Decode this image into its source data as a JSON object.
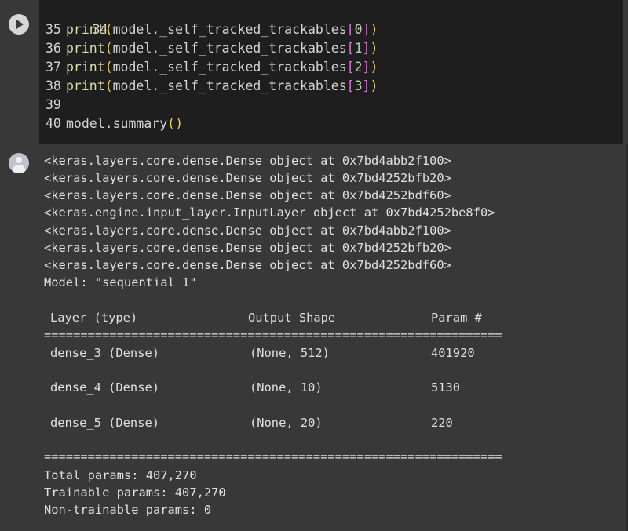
{
  "code_cell": {
    "lines": [
      {
        "num": "34",
        "fn": "",
        "arg_pre": "",
        "index": "",
        "arg_post": "",
        "raw": ""
      },
      {
        "num": "35",
        "fn": "print",
        "arg_pre": "model._self_tracked_trackables",
        "index": "0"
      },
      {
        "num": "36",
        "fn": "print",
        "arg_pre": "model._self_tracked_trackables",
        "index": "1"
      },
      {
        "num": "37",
        "fn": "print",
        "arg_pre": "model._self_tracked_trackables",
        "index": "2"
      },
      {
        "num": "38",
        "fn": "print",
        "arg_pre": "model._self_tracked_trackables",
        "index": "3"
      },
      {
        "num": "39",
        "fn": "",
        "arg_pre": "",
        "index": ""
      },
      {
        "num": "40",
        "obj": "model.",
        "fn": "summary",
        "call": "()"
      }
    ]
  },
  "output": {
    "print_lines": [
      "<keras.layers.core.dense.Dense object at 0x7bd4abb2f100>",
      "<keras.layers.core.dense.Dense object at 0x7bd4252bfb20>",
      "<keras.layers.core.dense.Dense object at 0x7bd4252bdf60>",
      "<keras.engine.input_layer.InputLayer object at 0x7bd4252be8f0>",
      "<keras.layers.core.dense.Dense object at 0x7bd4abb2f100>",
      "<keras.layers.core.dense.Dense object at 0x7bd4252bfb20>",
      "<keras.layers.core.dense.Dense object at 0x7bd4252bdf60>"
    ],
    "model_line": "Model: \"sequential_1\"",
    "summary": {
      "headers": [
        "Layer (type)",
        "Output Shape",
        "Param #"
      ],
      "separator": "=================================================================",
      "rows": [
        [
          "dense_3 (Dense)",
          "(None, 512)",
          "401920"
        ],
        [
          "dense_4 (Dense)",
          "(None, 10)",
          "5130"
        ],
        [
          "dense_5 (Dense)",
          "(None, 20)",
          "220"
        ]
      ],
      "total": "Total params: 407,270",
      "trainable": "Trainable params: 407,270",
      "non_trainable": "Non-trainable params: 0"
    }
  }
}
